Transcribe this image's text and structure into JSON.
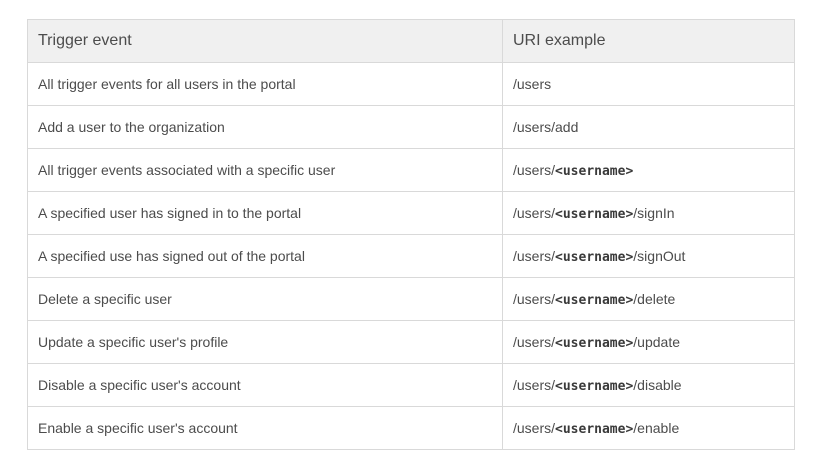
{
  "table": {
    "headers": [
      "Trigger event",
      "URI example"
    ],
    "rows": [
      {
        "event": "All trigger events for all users in the portal",
        "uri_prefix": "/users",
        "uri_code": "",
        "uri_suffix": ""
      },
      {
        "event": "Add a user to the organization",
        "uri_prefix": "/users/add",
        "uri_code": "",
        "uri_suffix": ""
      },
      {
        "event": "All trigger events associated with a specific user",
        "uri_prefix": "/users/",
        "uri_code": "<username>",
        "uri_suffix": ""
      },
      {
        "event": "A specified user has signed in to the portal",
        "uri_prefix": "/users/",
        "uri_code": "<username>",
        "uri_suffix": "/signIn"
      },
      {
        "event": "A specified use has signed out of the portal",
        "uri_prefix": "/users/",
        "uri_code": "<username>",
        "uri_suffix": "/signOut"
      },
      {
        "event": "Delete a specific user",
        "uri_prefix": "/users/",
        "uri_code": "<username>",
        "uri_suffix": "/delete"
      },
      {
        "event": "Update a specific user's profile",
        "uri_prefix": "/users/",
        "uri_code": "<username>",
        "uri_suffix": "/update"
      },
      {
        "event": "Disable a specific user's account",
        "uri_prefix": "/users/",
        "uri_code": "<username>",
        "uri_suffix": "/disable"
      },
      {
        "event": "Enable a specific user's account",
        "uri_prefix": "/users/",
        "uri_code": "<username>",
        "uri_suffix": "/enable"
      }
    ]
  }
}
